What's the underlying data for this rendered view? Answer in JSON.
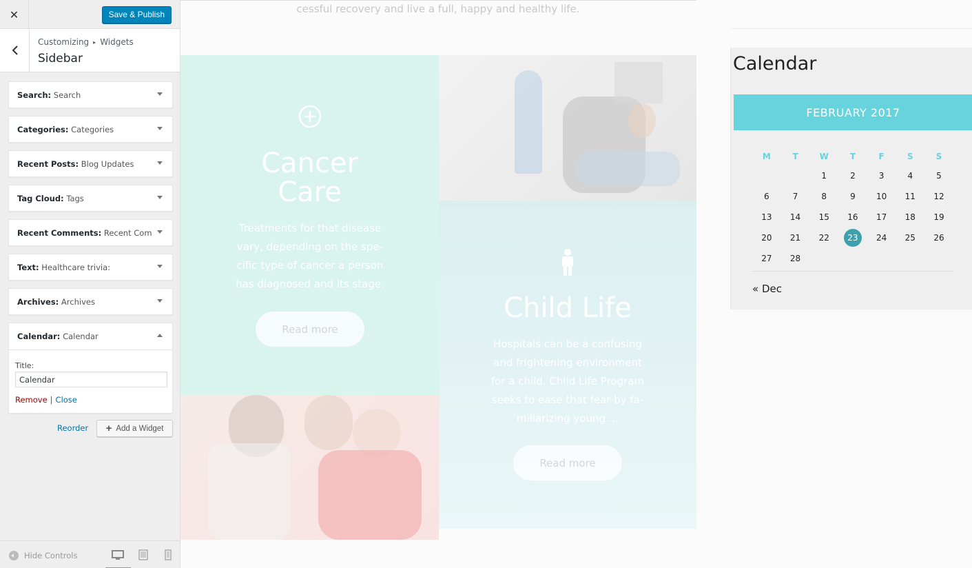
{
  "customizer": {
    "close_icon": "close-icon",
    "publish_label": "Save & Publish",
    "breadcrumb_root": "Customizing",
    "breadcrumb_sep": "▸",
    "breadcrumb_current": "Widgets",
    "section_title": "Sidebar",
    "widgets": [
      {
        "type": "Search:",
        "title": "Search"
      },
      {
        "type": "Categories:",
        "title": "Categories"
      },
      {
        "type": "Recent Posts:",
        "title": "Blog Updates"
      },
      {
        "type": "Tag Cloud:",
        "title": "Tags"
      },
      {
        "type": "Recent Comments:",
        "title": "Recent Com..."
      },
      {
        "type": "Text:",
        "title": "Healthcare trivia:"
      },
      {
        "type": "Archives:",
        "title": "Archives"
      },
      {
        "type": "Calendar:",
        "title": "Calendar"
      }
    ],
    "open_widget": {
      "title_label": "Title:",
      "title_value": "Calendar",
      "remove_label": "Remove",
      "separator": "|",
      "close_label": "Close"
    },
    "reorder_label": "Reorder",
    "add_widget_label": "Add a Widget",
    "hide_controls_label": "Hide Controls",
    "colors": {
      "primary": "#0085ba",
      "link": "#0073aa",
      "remove": "#aa0000"
    }
  },
  "preview": {
    "top_text": "cessful recovery and live a full, happy and healthy life.",
    "cancer": {
      "heading_line1": "Cancer",
      "heading_line2": "Care",
      "text": "Treatments for that disease vary, depending on the spe-cific type of cancer a person has diagnosed and its stage.",
      "button": "Read more"
    },
    "child": {
      "heading": "Child Life",
      "text": "Hospitals can be a confusing and frightening environment for a child. Child Life Program seeks to ease that fear by fa-miliarizing young ...",
      "button": "Read more"
    },
    "calendar": {
      "widget_title": "Calendar",
      "month": "FEBRUARY 2017",
      "weekdays": [
        "M",
        "T",
        "W",
        "T",
        "F",
        "S",
        "S"
      ],
      "weeks": [
        [
          "",
          "",
          "1",
          "2",
          "3",
          "4",
          "5"
        ],
        [
          "6",
          "7",
          "8",
          "9",
          "10",
          "11",
          "12"
        ],
        [
          "13",
          "14",
          "15",
          "16",
          "17",
          "18",
          "19"
        ],
        [
          "20",
          "21",
          "22",
          "23",
          "24",
          "25",
          "26"
        ],
        [
          "27",
          "28",
          "",
          "",
          "",
          "",
          ""
        ]
      ],
      "today": "23",
      "prev_link": "« Dec",
      "colors": {
        "header": "#67d3dd",
        "today": "#3e9fad"
      }
    }
  }
}
